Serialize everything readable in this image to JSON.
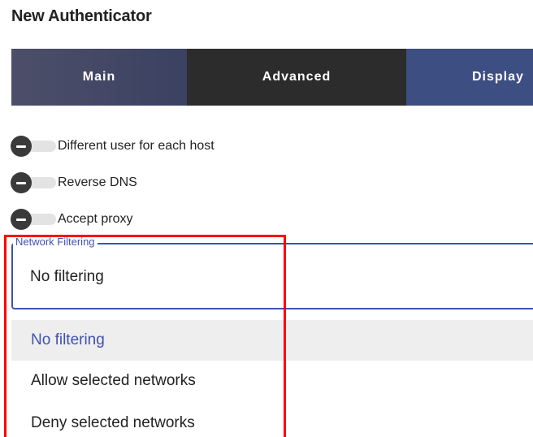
{
  "header": {
    "title": "New Authenticator"
  },
  "tabs": [
    {
      "label": "Main",
      "active": false
    },
    {
      "label": "Advanced",
      "active": true
    },
    {
      "label": "Display",
      "active": false
    }
  ],
  "toggles": [
    {
      "label": "Different user for each host",
      "checked": false
    },
    {
      "label": "Reverse DNS",
      "checked": false
    },
    {
      "label": "Accept proxy",
      "checked": false
    }
  ],
  "network_filtering": {
    "label": "Network Filtering",
    "value": "No filtering",
    "options": [
      {
        "label": "No filtering",
        "selected": true
      },
      {
        "label": "Allow selected networks",
        "selected": false
      },
      {
        "label": "Deny selected networks",
        "selected": false
      }
    ]
  },
  "colors": {
    "accent": "#3f51b5",
    "tab_active": "#2c2c2c",
    "tab_inactive": "#3d4e82",
    "highlight": "#ff0000"
  }
}
